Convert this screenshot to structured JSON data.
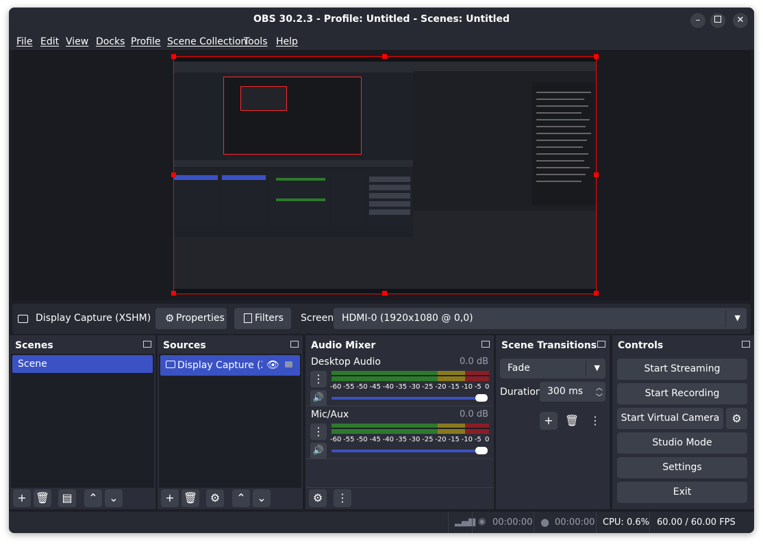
{
  "window": {
    "title": "OBS 30.2.3 - Profile: Untitled - Scenes: Untitled",
    "minimize_icon": "minimize-icon",
    "maximize_icon": "maximize-icon",
    "close_icon": "close-icon"
  },
  "menu": [
    "File",
    "Edit",
    "View",
    "Docks",
    "Profile",
    "Scene Collection",
    "Tools",
    "Help"
  ],
  "source_toolbar": {
    "source_name": "Display Capture (XSHM)",
    "properties_label": "Properties",
    "filters_label": "Filters",
    "screen_label": "Screen",
    "screen_value": "HDMI-0 (1920x1080 @ 0,0)"
  },
  "scenes": {
    "title": "Scenes",
    "items": [
      "Scene"
    ]
  },
  "sources": {
    "title": "Sources",
    "items": [
      "Display Capture (XSH"
    ]
  },
  "audio_mixer": {
    "title": "Audio Mixer",
    "channels": [
      {
        "name": "Desktop Audio",
        "level": "0.0 dB",
        "volume": 1.0
      },
      {
        "name": "Mic/Aux",
        "level": "0.0 dB",
        "volume": 1.0
      }
    ],
    "scale": [
      "-60",
      "-55",
      "-50",
      "-45",
      "-40",
      "-35",
      "-30",
      "-25",
      "-20",
      "-15",
      "-10",
      "-5",
      "0"
    ]
  },
  "scene_transitions": {
    "title": "Scene Transitions",
    "transition": "Fade",
    "duration_label": "Duration",
    "duration_value": "300 ms"
  },
  "controls": {
    "title": "Controls",
    "start_streaming": "Start Streaming",
    "start_recording": "Start Recording",
    "start_virtual_camera": "Start Virtual Camera",
    "studio_mode": "Studio Mode",
    "settings": "Settings",
    "exit": "Exit"
  },
  "status": {
    "stream_time": "00:00:00",
    "record_time": "00:00:00",
    "cpu": "CPU: 0.6%",
    "fps": "60.00 / 60.00 FPS"
  },
  "colors": {
    "selection": "#ff0000",
    "accent": "#3a52c4",
    "meter_green": "#2d7a2d",
    "meter_yellow": "#8a7a1e",
    "meter_red": "#8a1e26"
  }
}
